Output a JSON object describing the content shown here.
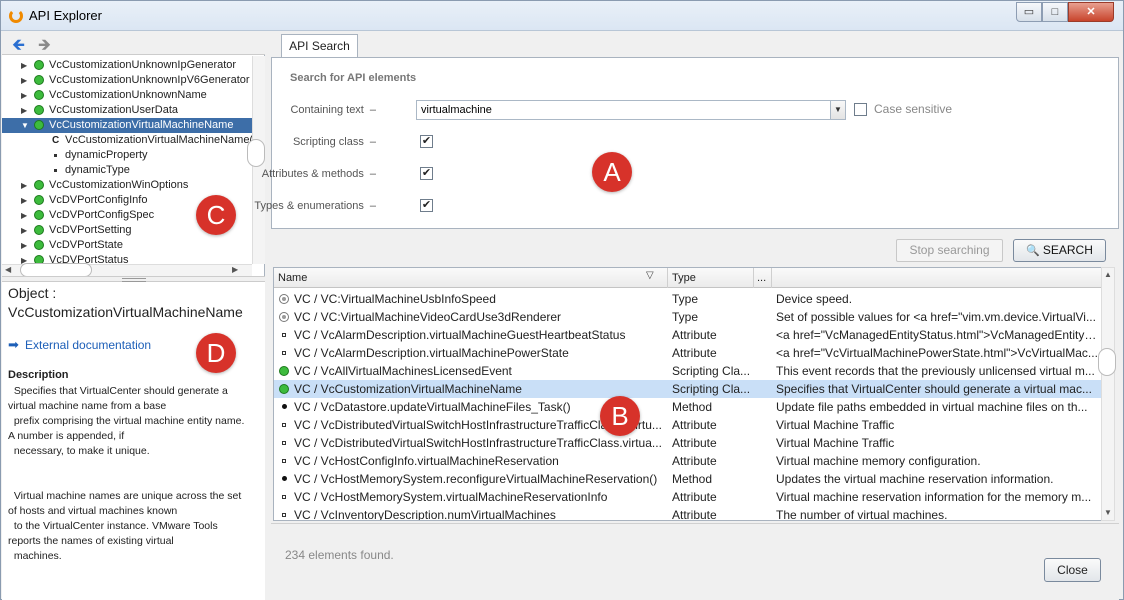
{
  "window": {
    "title": "API Explorer",
    "controls": {
      "minimize": "▭",
      "maximize": "□",
      "close": "✕"
    }
  },
  "nav": {
    "back_icon": "arrow-left-icon",
    "forward_icon": "arrow-right-icon"
  },
  "tree": {
    "items": [
      {
        "label": "VcCustomizationUnknownIpGenerator",
        "type": "node"
      },
      {
        "label": "VcCustomizationUnknownIpV6Generator",
        "type": "node"
      },
      {
        "label": "VcCustomizationUnknownName",
        "type": "node"
      },
      {
        "label": "VcCustomizationUserData",
        "type": "node"
      },
      {
        "label": "VcCustomizationVirtualMachineName",
        "type": "node",
        "selected": true,
        "expanded": true
      },
      {
        "label": "VcCustomizationVirtualMachineName()",
        "type": "child",
        "icon": "C"
      },
      {
        "label": "dynamicProperty",
        "type": "child",
        "icon": "square"
      },
      {
        "label": "dynamicType",
        "type": "child",
        "icon": "square"
      },
      {
        "label": "VcCustomizationWinOptions",
        "type": "node"
      },
      {
        "label": "VcDVPortConfigInfo",
        "type": "node"
      },
      {
        "label": "VcDVPortConfigSpec",
        "type": "node"
      },
      {
        "label": "VcDVPortSetting",
        "type": "node"
      },
      {
        "label": "VcDVPortState",
        "type": "node"
      },
      {
        "label": "VcDVPortStatus",
        "type": "node"
      }
    ]
  },
  "detail": {
    "object_label": "Object :",
    "object_name": "VcCustomizationVirtualMachineName",
    "external_link": "External documentation",
    "description_title": "Description",
    "description_text": "  Specifies that VirtualCenter should generate a\nvirtual machine name from a base\n  prefix comprising the virtual machine entity name.\nA number is appended, if\n  necessary, to make it unique.\n\n\n  Virtual machine names are unique across the set\nof hosts and virtual machines known\n  to the VirtualCenter instance. VMware Tools\nreports the names of existing virtual\n  machines."
  },
  "search": {
    "tab_label": "API Search",
    "section_title": "Search for API elements",
    "containing_label": "Containing text",
    "containing_value": "virtualmachine",
    "case_label": "Case sensitive",
    "case_checked": false,
    "scripting_label": "Scripting class",
    "scripting_checked": true,
    "attributes_label": "Attributes & methods",
    "attributes_checked": true,
    "types_label": "Types & enumerations",
    "types_checked": true,
    "dash": "–",
    "check": "✔"
  },
  "buttons": {
    "stop": "Stop searching",
    "search": "SEARCH",
    "close": "Close"
  },
  "results": {
    "columns": [
      "Name",
      "Type",
      "..."
    ],
    "rows": [
      {
        "icon": "grey-circle",
        "name": "VC / VC:VirtualMachineUsbInfoSpeed",
        "type": "Type",
        "desc": "Device speed."
      },
      {
        "icon": "grey-circle",
        "name": "VC / VC:VirtualMachineVideoCardUse3dRenderer",
        "type": "Type",
        "desc": "Set of possible values for <a href=\"vim.vm.device.VirtualVi..."
      },
      {
        "icon": "square",
        "name": "VC / VcAlarmDescription.virtualMachineGuestHeartbeatStatus",
        "type": "Attribute",
        "desc": "<a href=\"VcManagedEntityStatus.html\">VcManagedEntityS..."
      },
      {
        "icon": "square",
        "name": "VC / VcAlarmDescription.virtualMachinePowerState",
        "type": "Attribute",
        "desc": "<a href=\"VcVirtualMachinePowerState.html\">VcVirtualMac..."
      },
      {
        "icon": "green-circle",
        "name": "VC / VcAllVirtualMachinesLicensedEvent",
        "type": "Scripting Cla...",
        "desc": "This event records that the previously unlicensed virtual m..."
      },
      {
        "icon": "green-circle",
        "name": "VC / VcCustomizationVirtualMachineName",
        "type": "Scripting Cla...",
        "desc": "Specifies that VirtualCenter should generate a virtual mac...",
        "selected": true
      },
      {
        "icon": "dot",
        "name": "VC / VcDatastore.updateVirtualMachineFiles_Task()",
        "type": "Method",
        "desc": "Update file paths embedded in virtual machine files on th..."
      },
      {
        "icon": "square",
        "name": "VC / VcDistributedVirtualSwitchHostInfrastructureTrafficClass._virtu...",
        "type": "Attribute",
        "desc": "Virtual Machine Traffic"
      },
      {
        "icon": "square",
        "name": "VC / VcDistributedVirtualSwitchHostInfrastructureTrafficClass.virtua...",
        "type": "Attribute",
        "desc": "Virtual Machine Traffic"
      },
      {
        "icon": "square",
        "name": "VC / VcHostConfigInfo.virtualMachineReservation",
        "type": "Attribute",
        "desc": "Virtual machine memory configuration."
      },
      {
        "icon": "dot",
        "name": "VC / VcHostMemorySystem.reconfigureVirtualMachineReservation()",
        "type": "Method",
        "desc": "Updates the virtual machine reservation information."
      },
      {
        "icon": "square",
        "name": "VC / VcHostMemorySystem.virtualMachineReservationInfo",
        "type": "Attribute",
        "desc": "Virtual machine reservation information for the memory m..."
      },
      {
        "icon": "square",
        "name": "VC / VcInventoryDescription.numVirtualMachines",
        "type": "Attribute",
        "desc": "The number of virtual machines."
      }
    ]
  },
  "status": {
    "found": "234 elements found."
  },
  "annotations": {
    "a": "A",
    "b": "B",
    "c": "C",
    "d": "D"
  },
  "colors": {
    "selection": "#3d6ea8",
    "row_selection": "#c9dff7",
    "annotation": "#d7322a"
  }
}
